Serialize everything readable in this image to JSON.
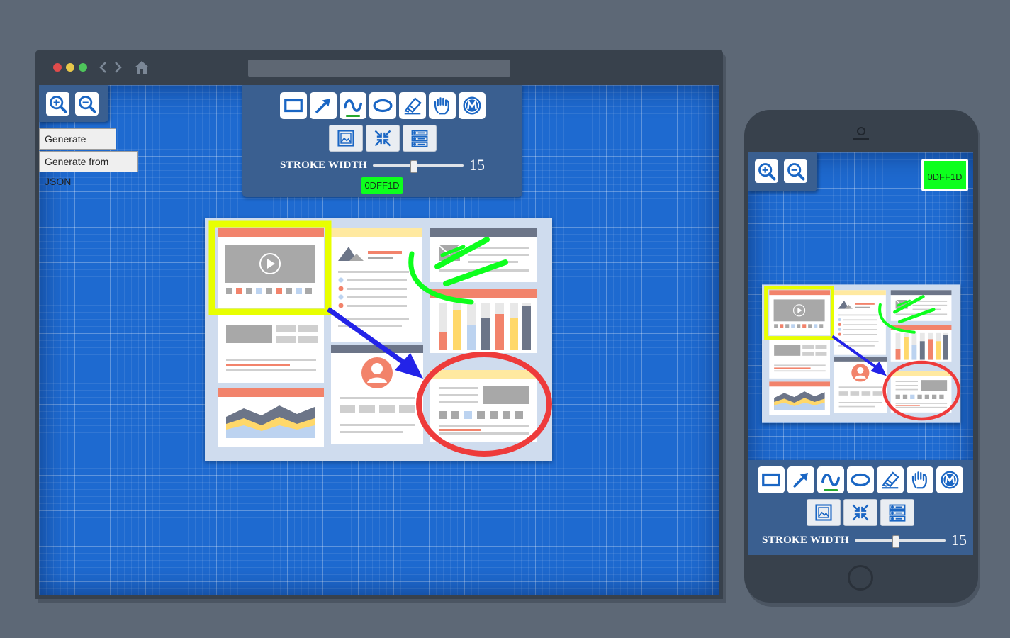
{
  "desktop": {
    "zoom": {
      "in_icon": "zoom-in-icon",
      "out_icon": "zoom-out-icon"
    },
    "buttons": {
      "generate_json": "Generate JSON",
      "generate_from_json": "Generate from JSON"
    },
    "tools": [
      "rectangle-tool",
      "arrow-tool",
      "freehand-tool",
      "ellipse-tool",
      "eraser-tool",
      "pan-tool",
      "logo-tool"
    ],
    "actions": [
      "image-upload",
      "fit-to-screen",
      "layers"
    ],
    "stroke": {
      "label": "STROKE WIDTH",
      "value": "15",
      "level": 0.45
    },
    "color": {
      "label": "0DFF1D",
      "hex": "#0DFF1D"
    }
  },
  "mobile": {
    "stroke": {
      "label": "STROKE WIDTH",
      "value": "15",
      "level": 0.45
    },
    "color": {
      "label": "0DFF1D",
      "hex": "#0DFF1D"
    }
  },
  "annotations": {
    "rectangle_color": "#E8FF00",
    "arrow_color": "#2323E8",
    "ellipse_color": "#EE3B3B",
    "freehand_color": "#0DFF1D"
  },
  "colors": {
    "window_dots": [
      "#e04b4b",
      "#e8c84a",
      "#4ec55b"
    ],
    "background": "#5d6876",
    "panel": "#3a5f90",
    "canvas": "#1e6ad0"
  }
}
